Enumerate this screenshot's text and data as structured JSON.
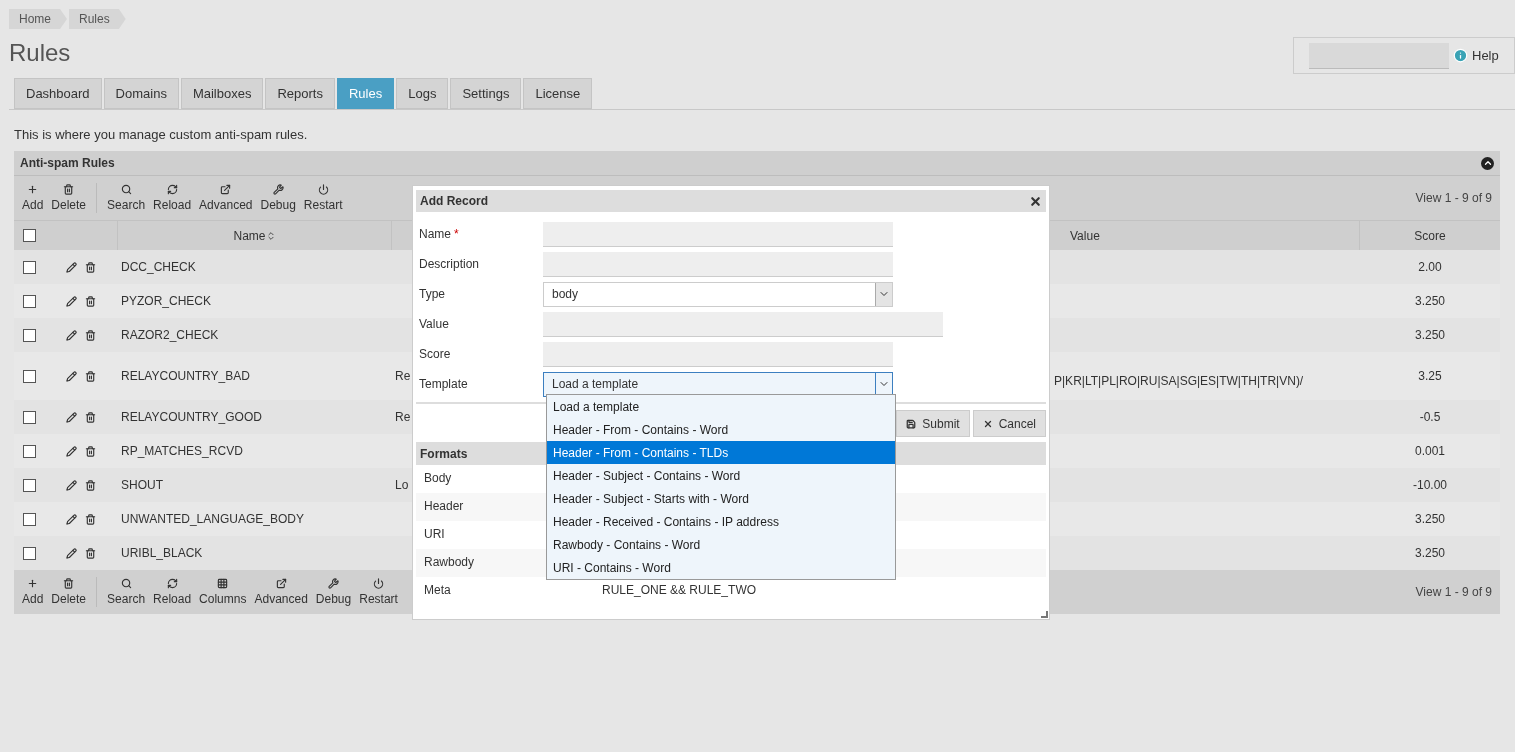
{
  "breadcrumbs": [
    "Home",
    "Rules"
  ],
  "page_title": "Rules",
  "help": {
    "label": "Help"
  },
  "tabs": [
    {
      "label": "Dashboard",
      "selected": false
    },
    {
      "label": "Domains",
      "selected": false
    },
    {
      "label": "Mailboxes",
      "selected": false
    },
    {
      "label": "Reports",
      "selected": false
    },
    {
      "label": "Rules",
      "selected": true
    },
    {
      "label": "Logs",
      "selected": false
    },
    {
      "label": "Settings",
      "selected": false
    },
    {
      "label": "License",
      "selected": false
    }
  ],
  "intro": "This is where you manage custom anti-spam rules.",
  "grid": {
    "title": "Anti-spam Rules",
    "top_toolbar": [
      {
        "kind": "add",
        "label": "Add"
      },
      {
        "kind": "delete",
        "label": "Delete"
      },
      {
        "kind": "search",
        "label": "Search"
      },
      {
        "kind": "reload",
        "label": "Reload"
      },
      {
        "kind": "advanced",
        "label": "Advanced"
      },
      {
        "kind": "debug",
        "label": "Debug"
      },
      {
        "kind": "restart",
        "label": "Restart"
      }
    ],
    "pager": "View 1 - 9 of 9",
    "select_all_checked": false,
    "columns": {
      "name": "Name",
      "value": "Value",
      "score": "Score"
    },
    "rows": [
      {
        "checked": false,
        "name": "DCC_CHECK",
        "score": "2.00"
      },
      {
        "checked": false,
        "name": "PYZOR_CHECK",
        "score": "3.250"
      },
      {
        "checked": false,
        "name": "RAZOR2_CHECK",
        "score": "3.250"
      },
      {
        "checked": false,
        "name": "RELAYCOUNTRY_BAD",
        "column_4": "Re",
        "value": "P|KR|LT|PL|RO|RU|SA|SG|ES|TW|TH|TR|VN)/",
        "score": "3.25"
      },
      {
        "checked": false,
        "name": "RELAYCOUNTRY_GOOD",
        "column_4": "Re",
        "score": "-0.5"
      },
      {
        "checked": false,
        "name": "RP_MATCHES_RCVD",
        "score": "0.001"
      },
      {
        "checked": false,
        "name": "SHOUT",
        "column_4": "Lo",
        "score": "-10.00"
      },
      {
        "checked": false,
        "name": "UNWANTED_LANGUAGE_BODY",
        "score": "3.250"
      },
      {
        "checked": false,
        "name": "URIBL_BLACK",
        "score": "3.250"
      }
    ],
    "bottom_toolbar": [
      {
        "kind": "add",
        "label": "Add"
      },
      {
        "kind": "delete",
        "label": "Delete"
      },
      {
        "kind": "search",
        "label": "Search"
      },
      {
        "kind": "reload",
        "label": "Reload"
      },
      {
        "kind": "columns",
        "label": "Columns"
      },
      {
        "kind": "advanced",
        "label": "Advanced"
      },
      {
        "kind": "debug",
        "label": "Debug"
      },
      {
        "kind": "restart",
        "label": "Restart"
      }
    ],
    "bottom_pager": "View 1 - 9 of 9"
  },
  "dialog": {
    "title": "Add Record",
    "fields": [
      {
        "label": "Name",
        "required_mark": "*",
        "kind": "text"
      },
      {
        "label": "Description",
        "kind": "text"
      },
      {
        "label": "Type",
        "kind": "select",
        "value": "body"
      },
      {
        "label": "Value",
        "kind": "wide"
      },
      {
        "label": "Score",
        "kind": "text"
      },
      {
        "label": "Template",
        "kind": "open_select",
        "value": "Load a template"
      }
    ],
    "template_options": [
      {
        "label": "Load a template",
        "selected": false
      },
      {
        "label": "Header - From - Contains - Word",
        "selected": false
      },
      {
        "label": "Header - From - Contains - TLDs",
        "selected": true
      },
      {
        "label": "Header - Subject - Contains - Word",
        "selected": false
      },
      {
        "label": "Header - Subject - Starts with - Word",
        "selected": false
      },
      {
        "label": "Header - Received - Contains - IP address",
        "selected": false
      },
      {
        "label": "Rawbody - Contains - Word",
        "selected": false
      },
      {
        "label": "URI - Contains - Word",
        "selected": false
      }
    ],
    "buttons": [
      {
        "kind": "submit",
        "label": "Submit"
      },
      {
        "kind": "cancel",
        "label": "Cancel"
      }
    ],
    "formats": {
      "title": "Formats",
      "rows": [
        {
          "label": "Body"
        },
        {
          "label": "Header"
        },
        {
          "label": "URI"
        },
        {
          "label": "Rawbody"
        },
        {
          "label": "Meta",
          "value": "RULE_ONE && RULE_TWO"
        }
      ]
    }
  }
}
